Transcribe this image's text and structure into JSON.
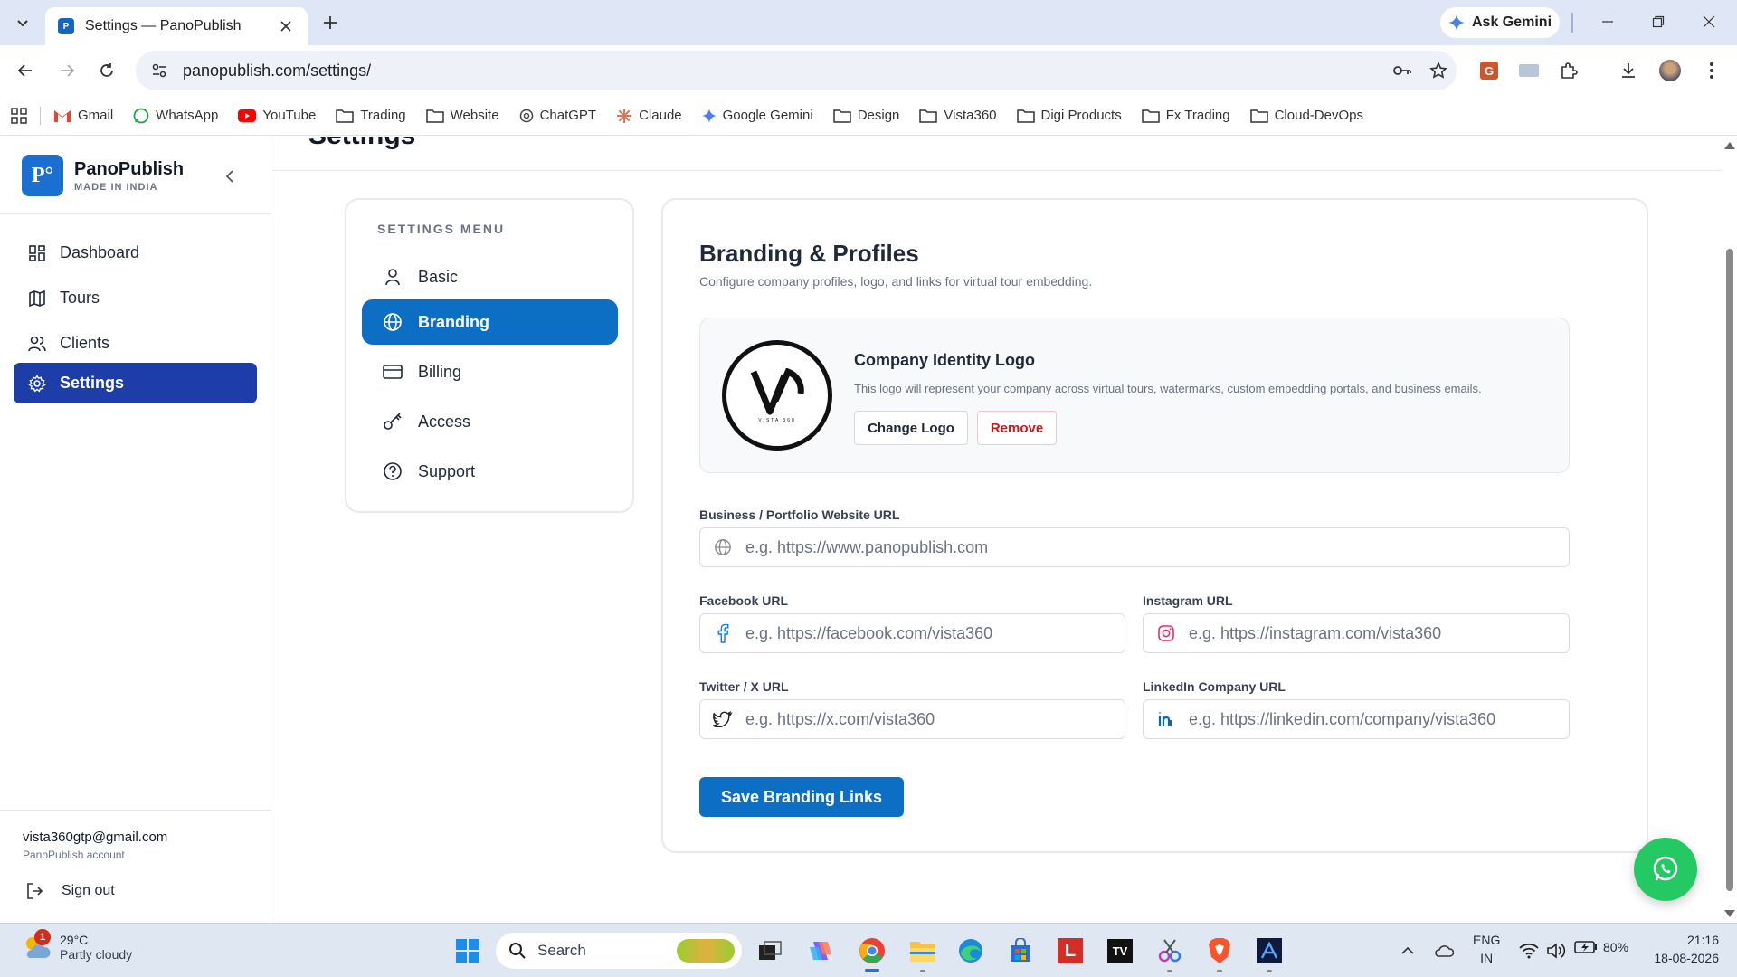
{
  "browser": {
    "tab_title": "Settings — PanoPublish",
    "tab_favicon": "P",
    "ask_gemini": "Ask Gemini",
    "url": "panopublish.com/settings/",
    "bookmarks": [
      {
        "label": "Gmail",
        "icon": "gmail-icon"
      },
      {
        "label": "WhatsApp",
        "icon": "whatsapp-icon"
      },
      {
        "label": "YouTube",
        "icon": "youtube-icon"
      },
      {
        "label": "Trading",
        "icon": "folder-icon"
      },
      {
        "label": "Website",
        "icon": "folder-icon"
      },
      {
        "label": "ChatGPT",
        "icon": "chatgpt-icon"
      },
      {
        "label": "Claude",
        "icon": "claude-icon"
      },
      {
        "label": "Google Gemini",
        "icon": "gemini-icon"
      },
      {
        "label": "Design",
        "icon": "folder-icon"
      },
      {
        "label": "Vista360",
        "icon": "folder-icon"
      },
      {
        "label": "Digi Products",
        "icon": "folder-icon"
      },
      {
        "label": "Fx Trading",
        "icon": "folder-icon"
      },
      {
        "label": "Cloud-DevOps",
        "icon": "folder-icon"
      }
    ]
  },
  "sidebar": {
    "brand_logo": "P°",
    "brand_name": "PanoPublish",
    "brand_tagline": "MADE IN INDIA",
    "items": [
      {
        "label": "Dashboard",
        "icon": "dashboard-icon"
      },
      {
        "label": "Tours",
        "icon": "map-icon"
      },
      {
        "label": "Clients",
        "icon": "users-icon"
      },
      {
        "label": "Settings",
        "icon": "gear-icon",
        "active": true
      }
    ],
    "account_email": "vista360gtp@gmail.com",
    "account_label": "PanoPublish account",
    "sign_out": "Sign out"
  },
  "main": {
    "page_title": "Settings",
    "settings_menu": {
      "heading": "SETTINGS MENU",
      "items": [
        {
          "label": "Basic",
          "icon": "user-icon"
        },
        {
          "label": "Branding",
          "icon": "globe-icon",
          "active": true
        },
        {
          "label": "Billing",
          "icon": "credit-card-icon"
        },
        {
          "label": "Access",
          "icon": "key-icon"
        },
        {
          "label": "Support",
          "icon": "help-circle-icon"
        }
      ]
    },
    "branding": {
      "title": "Branding & Profiles",
      "subtitle": "Configure company profiles, logo, and links for virtual tour embedding.",
      "logo_caption": "VISTA 360",
      "logo_title": "Company Identity Logo",
      "logo_description": "This logo will represent your company across virtual tours, watermarks, custom embedding portals, and business emails.",
      "change_logo": "Change Logo",
      "remove": "Remove",
      "fields": {
        "website": {
          "label": "Business / Portfolio Website URL",
          "placeholder": "e.g. https://www.panopublish.com",
          "value": ""
        },
        "facebook": {
          "label": "Facebook URL",
          "placeholder": "e.g. https://facebook.com/vista360",
          "value": ""
        },
        "instagram": {
          "label": "Instagram URL",
          "placeholder": "e.g. https://instagram.com/vista360",
          "value": ""
        },
        "twitter": {
          "label": "Twitter / X URL",
          "placeholder": "e.g. https://x.com/vista360",
          "value": ""
        },
        "linkedin": {
          "label": "LinkedIn Company URL",
          "placeholder": "e.g. https://linkedin.com/company/vista360",
          "value": ""
        }
      },
      "save_button": "Save Branding Links"
    }
  },
  "taskbar": {
    "weather_badge": "1",
    "weather_temp": "29°C",
    "weather_condition": "Partly cloudy",
    "search_placeholder": "Search",
    "lang_1": "ENG",
    "lang_2": "IN",
    "battery": "80%",
    "time": "21:16",
    "date": "18-08-2026"
  },
  "colors": {
    "sidebar_active": "#1d3ea8",
    "primary": "#0d6fc4",
    "remove_text": "#d0161c",
    "whatsapp": "#25c963"
  }
}
